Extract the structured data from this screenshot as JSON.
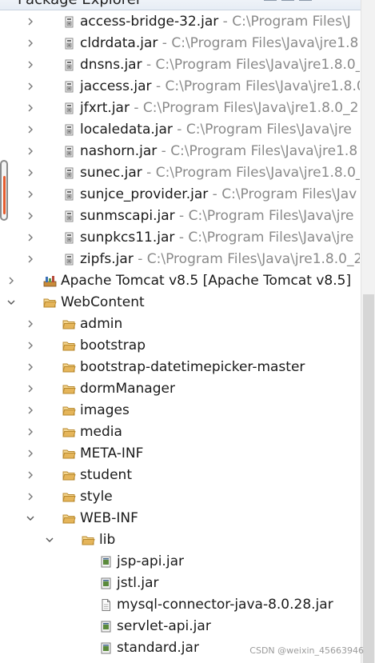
{
  "title": "Package Explorer",
  "watermark": "CSDN @weixin_45663946",
  "tree": [
    {
      "kind": "jar",
      "name": "access-bridge-32.jar",
      "path": "C:\\Program Files\\J",
      "expanded": false
    },
    {
      "kind": "jar",
      "name": "cldrdata.jar",
      "path": "C:\\Program Files\\Java\\jre1.8",
      "expanded": false
    },
    {
      "kind": "jar",
      "name": "dnsns.jar",
      "path": "C:\\Program Files\\Java\\jre1.8.0_",
      "expanded": false
    },
    {
      "kind": "jar",
      "name": "jaccess.jar",
      "path": "C:\\Program Files\\Java\\jre1.8.0",
      "expanded": false
    },
    {
      "kind": "jar",
      "name": "jfxrt.jar",
      "path": "C:\\Program Files\\Java\\jre1.8.0_2",
      "expanded": false
    },
    {
      "kind": "jar",
      "name": "localedata.jar",
      "path": "C:\\Program Files\\Java\\jre",
      "expanded": false
    },
    {
      "kind": "jar",
      "name": "nashorn.jar",
      "path": "C:\\Program Files\\Java\\jre1.8",
      "expanded": false
    },
    {
      "kind": "jar",
      "name": "sunec.jar",
      "path": "C:\\Program Files\\Java\\jre1.8.0_",
      "expanded": false
    },
    {
      "kind": "jar",
      "name": "sunjce_provider.jar",
      "path": "C:\\Program Files\\Jav",
      "expanded": false
    },
    {
      "kind": "jar",
      "name": "sunmscapi.jar",
      "path": "C:\\Program Files\\Java\\jre",
      "expanded": false
    },
    {
      "kind": "jar",
      "name": "sunpkcs11.jar",
      "path": "C:\\Program Files\\Java\\jre",
      "expanded": false
    },
    {
      "kind": "jar",
      "name": "zipfs.jar",
      "path": "C:\\Program Files\\Java\\jre1.8.0_2",
      "expanded": false
    },
    {
      "kind": "library",
      "name": "Apache Tomcat v8.5 [Apache Tomcat v8.5]",
      "path": "",
      "expanded": false
    },
    {
      "kind": "folder",
      "name": "WebContent",
      "path": "",
      "expanded": true
    },
    {
      "kind": "folder",
      "name": "admin",
      "path": "",
      "expanded": false
    },
    {
      "kind": "folder",
      "name": "bootstrap",
      "path": "",
      "expanded": false
    },
    {
      "kind": "folder",
      "name": "bootstrap-datetimepicker-master",
      "path": "",
      "expanded": false
    },
    {
      "kind": "folder",
      "name": "dormManager",
      "path": "",
      "expanded": false
    },
    {
      "kind": "folder",
      "name": "images",
      "path": "",
      "expanded": false
    },
    {
      "kind": "folder",
      "name": "media",
      "path": "",
      "expanded": false
    },
    {
      "kind": "folder",
      "name": "META-INF",
      "path": "",
      "expanded": false
    },
    {
      "kind": "folder",
      "name": "student",
      "path": "",
      "expanded": false
    },
    {
      "kind": "folder",
      "name": "style",
      "path": "",
      "expanded": false
    },
    {
      "kind": "folder",
      "name": "WEB-INF",
      "path": "",
      "expanded": true
    },
    {
      "kind": "folder",
      "name": "lib",
      "path": "",
      "expanded": true
    },
    {
      "kind": "jarfile",
      "name": "jsp-api.jar",
      "path": "",
      "expanded": false
    },
    {
      "kind": "jarfile",
      "name": "jstl.jar",
      "path": "",
      "expanded": false
    },
    {
      "kind": "file",
      "name": "mysql-connector-java-8.0.28.jar",
      "path": "",
      "expanded": false
    },
    {
      "kind": "jarfile",
      "name": "servlet-api.jar",
      "path": "",
      "expanded": false
    },
    {
      "kind": "jarfile",
      "name": "standard.jar",
      "path": "",
      "expanded": false
    }
  ],
  "icons": {
    "jar": "jar-archive-icon",
    "library": "library-icon",
    "folder": "folder-icon",
    "jarfile": "jar-file-icon",
    "file": "file-icon",
    "collapsed": "chevron-right-icon",
    "expanded": "chevron-down-icon"
  },
  "colors": {
    "folder": "#e5b55a",
    "path_text": "#8a8a8a",
    "scroll_marker": "#e65c2e"
  }
}
